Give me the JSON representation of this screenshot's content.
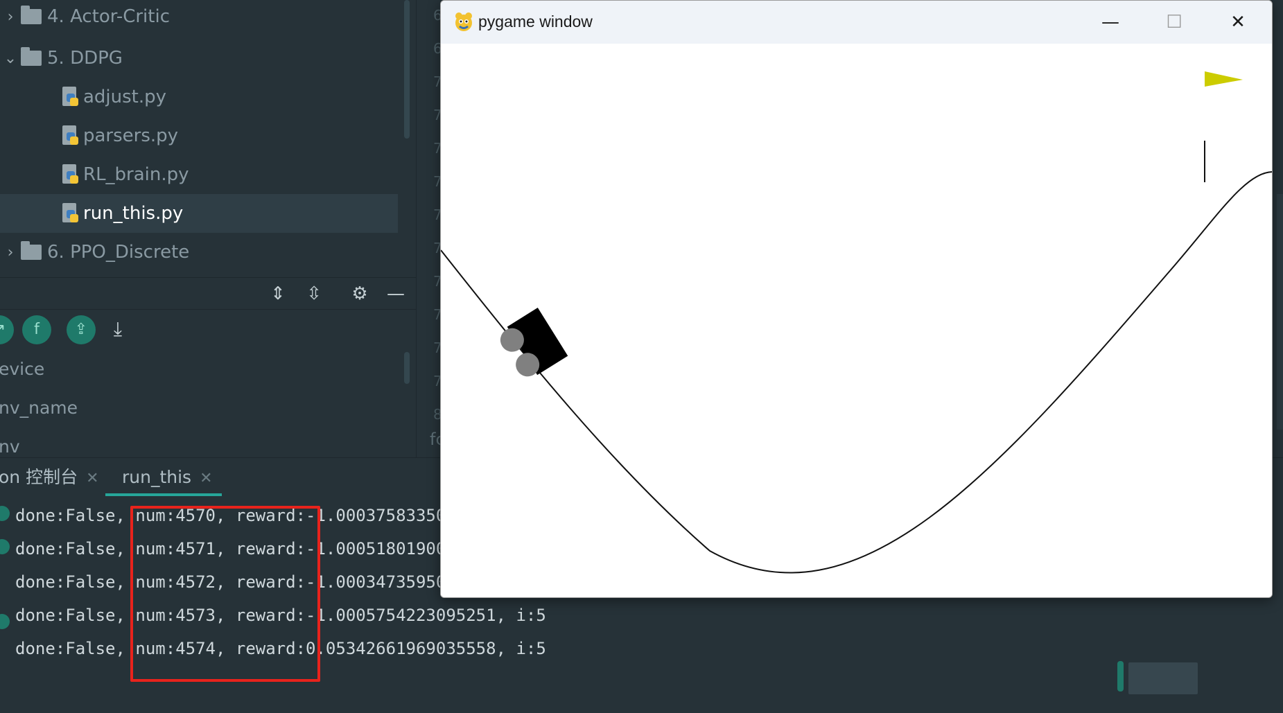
{
  "tree": {
    "items": [
      {
        "label": "4. Actor-Critic",
        "type": "folder",
        "expanded": false
      },
      {
        "label": "5. DDPG",
        "type": "folder",
        "expanded": true
      },
      {
        "label": "adjust.py",
        "type": "python-file"
      },
      {
        "label": "parsers.py",
        "type": "python-file"
      },
      {
        "label": "RL_brain.py",
        "type": "python-file"
      },
      {
        "label": "run_this.py",
        "type": "python-file",
        "selected": true
      },
      {
        "label": "6. PPO_Discrete",
        "type": "folder",
        "expanded": false
      }
    ]
  },
  "toolbar_icons": [
    "expand-all-icon",
    "collapse-all-icon",
    "gear-icon",
    "minimize-icon"
  ],
  "structure": {
    "buttons": [
      "navigate-icon",
      "field-icon",
      "sort-up-icon",
      "sort-down-icon"
    ],
    "field_badge": "f",
    "items": [
      "evice",
      "nv_name",
      "nv"
    ]
  },
  "gutter": {
    "line_numbers": [
      "6",
      "6",
      "7",
      "7",
      "7",
      "7",
      "7",
      "7",
      "7",
      "7",
      "7",
      "7",
      "8"
    ],
    "tab_stub": "fc"
  },
  "run_tabs": [
    {
      "label": "on 控制台",
      "active": false
    },
    {
      "label": "run_this",
      "active": true
    }
  ],
  "console": {
    "lines": [
      "done:False, num:4570, reward:-1.000375833500",
      "done:False, num:4571, reward:-1.000518019006",
      "done:False, num:4572, reward:-1.000347359508",
      "done:False, num:4573, reward:-1.0005754223095251, i:5",
      "done:False, num:4574, reward:0.05342661969035558, i:5"
    ],
    "highlight_color": "#e8231c"
  },
  "pygame": {
    "title": "pygame window",
    "controls": {
      "minimize": "—",
      "maximize": "☐",
      "close": "✕"
    },
    "flag_color": "#cccc00",
    "car_color": "#000000",
    "wheel_color": "#808080"
  },
  "colors": {
    "ide_background": "#263238",
    "accent": "#26a69a",
    "selection": "#2f3e46"
  }
}
